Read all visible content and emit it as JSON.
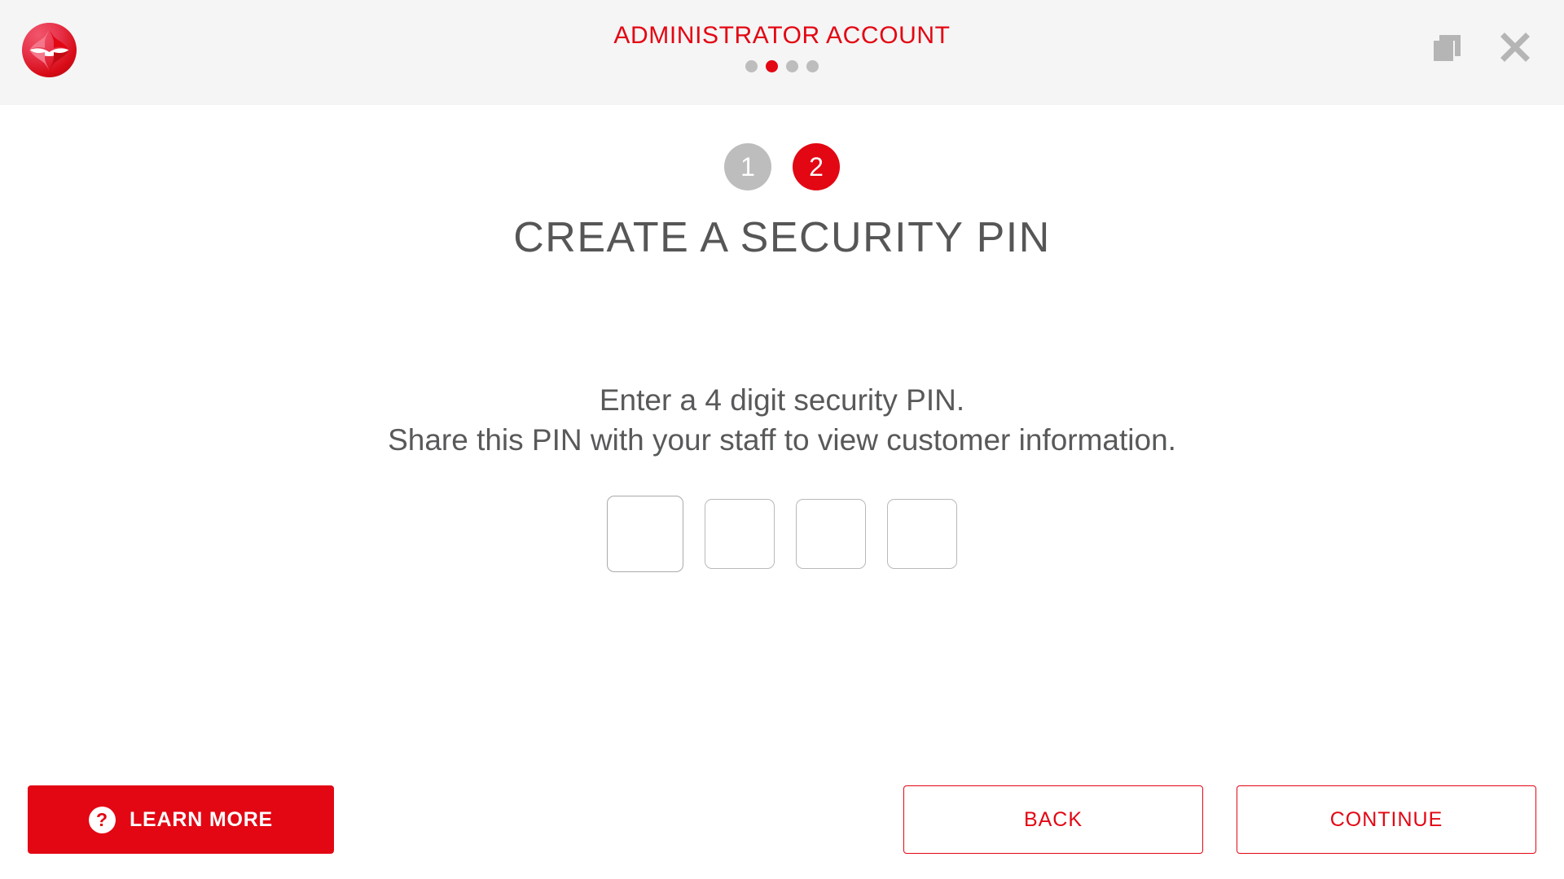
{
  "colors": {
    "brand_red": "#e30613",
    "header_bg": "#f5f5f5",
    "page_bg": "#ffffff",
    "inactive_gray": "#bdbdbd",
    "title_gray": "#565656",
    "icon_gray": "#b5b5b5"
  },
  "header": {
    "logo_name": "santander-flame-logo",
    "title": "ADMINISTRATOR ACCOUNT",
    "progress_dots": {
      "count": 4,
      "active_index": 1
    },
    "actions": [
      {
        "name": "restore-window-icon",
        "label": "Restore"
      },
      {
        "name": "close-icon",
        "label": "Close"
      }
    ]
  },
  "main": {
    "steps": [
      {
        "label": "1",
        "active": false
      },
      {
        "label": "2",
        "active": true
      }
    ],
    "page_title": "CREATE A SECURITY PIN",
    "instructions": {
      "line1": "Enter a 4 digit security PIN.",
      "line2": "Share this PIN with your staff to view customer information."
    },
    "pin": {
      "digits": 4,
      "values": [
        "",
        "",
        "",
        ""
      ],
      "focused_index": 0,
      "placeholder": ""
    }
  },
  "footer": {
    "learn_more": {
      "label": "LEARN MORE",
      "icon": "question-mark-icon",
      "icon_glyph": "?"
    },
    "back": {
      "label": "BACK"
    },
    "continue": {
      "label": "CONTINUE"
    }
  }
}
